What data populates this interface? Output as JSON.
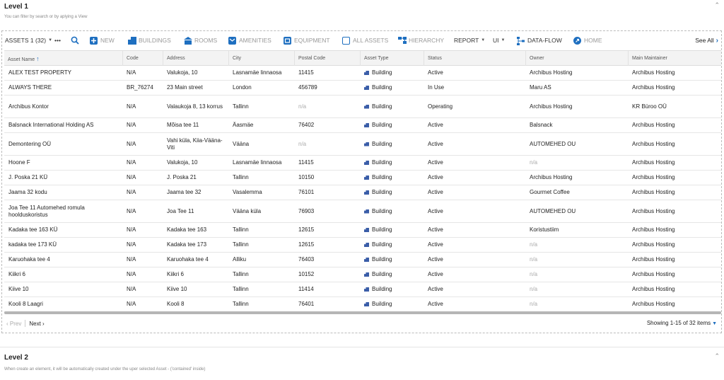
{
  "level1": {
    "title": "Level 1",
    "subtitle": "You can filter by search or by aplying a View"
  },
  "level2": {
    "title": "Level 2",
    "subtitle": "When create an element, it will be automatically created under the uper selected Asset - ('contained' inside)"
  },
  "toolbar": {
    "assets_label": "ASSETS 1 (32)",
    "more": "•••",
    "new": "NEW",
    "buildings": "BUILDINGS",
    "rooms": "ROOMS",
    "amenities": "AMENITIES",
    "equipment": "EQUIPMENT",
    "all_assets": "ALL ASSETS",
    "hierarchy": "HIERARCHY",
    "report": "REPORT",
    "ui": "UI",
    "data_flow": "DATA-FLOW",
    "home": "HOME",
    "see_all": "See All",
    "accent": "#1e6fc0"
  },
  "columns": [
    "Asset Name",
    "Code",
    "Address",
    "City",
    "Postal Code",
    "Asset Type",
    "Status",
    "Owner",
    "Main Maintainer"
  ],
  "rows": [
    [
      "ALEX TEST PROPERTY",
      "N/A",
      "Valukoja, 10",
      "Lasnamäe linnaosa",
      "11415",
      "Building",
      "Active",
      "Archibus Hosting",
      "Archibus Hosting"
    ],
    [
      "ALWAYS THERE",
      "BR_76274",
      "23 Main street",
      "London",
      "456789",
      "Building",
      "In Use",
      "Maru AS",
      "Archibus Hosting"
    ],
    [
      "Archibus Kontor",
      "N/A",
      "Valaukoja 8, 13 korrus",
      "Tallinn",
      "n/a",
      "Building",
      "Operating",
      "Archibus Hosting",
      "KR Büroo OÜ"
    ],
    [
      "Balsnack International Holding AS",
      "N/A",
      "Mõisa tee 11",
      "Äasmäe",
      "76402",
      "Building",
      "Active",
      "Balsnack",
      "Archibus Hosting"
    ],
    [
      "Demontering OÜ",
      "N/A",
      "Vahi küla, Kiia-Vääna-Viti",
      "Vääna",
      "n/a",
      "Building",
      "Active",
      "AUTOMEHED OU",
      "Archibus Hosting"
    ],
    [
      "Hoone F",
      "N/A",
      "Valukoja, 10",
      "Lasnamäe linnaosa",
      "11415",
      "Building",
      "Active",
      "n/a",
      "Archibus Hosting"
    ],
    [
      "J. Poska 21 KÜ",
      "N/A",
      "J. Poska 21",
      "Tallinn",
      "10150",
      "Building",
      "Active",
      "Archibus Hosting",
      "Archibus Hosting"
    ],
    [
      "Jaama 32 kodu",
      "N/A",
      "Jaama tee 32",
      "Vasalemma",
      "76101",
      "Building",
      "Active",
      "Gourmet Coffee",
      "Archibus Hosting"
    ],
    [
      "Joa Tee 11 Automehed romula hoolduskoristus",
      "N/A",
      "Joa Tee 11",
      "Vääna küla",
      "76903",
      "Building",
      "Active",
      "AUTOMEHED OU",
      "Archibus Hosting"
    ],
    [
      "Kadaka tee 163 KÜ",
      "N/A",
      "Kadaka tee 163",
      "Tallinn",
      "12615",
      "Building",
      "Active",
      "Koristustiim",
      "Archibus Hosting"
    ],
    [
      "kadaka tee 173 KÜ",
      "N/A",
      "Kadaka tee 173",
      "Tallinn",
      "12615",
      "Building",
      "Active",
      "n/a",
      "Archibus Hosting"
    ],
    [
      "Karuohaka tee 4",
      "N/A",
      "Karuohaka tee 4",
      "Alliku",
      "76403",
      "Building",
      "Active",
      "n/a",
      "Archibus Hosting"
    ],
    [
      "Kiikri 6",
      "N/A",
      "Kiikri 6",
      "Tallinn",
      "10152",
      "Building",
      "Active",
      "n/a",
      "Archibus Hosting"
    ],
    [
      "Kiive 10",
      "N/A",
      "Kiive 10",
      "Tallinn",
      "11414",
      "Building",
      "Active",
      "n/a",
      "Archibus Hosting"
    ],
    [
      "Kooli 8 Laagri",
      "N/A",
      "Kooli 8",
      "Tallinn",
      "76401",
      "Building",
      "Active",
      "n/a",
      "Archibus Hosting"
    ]
  ],
  "pager": {
    "prev": "Prev",
    "next": "Next",
    "showing": "Showing 1-15 of 32 items"
  }
}
